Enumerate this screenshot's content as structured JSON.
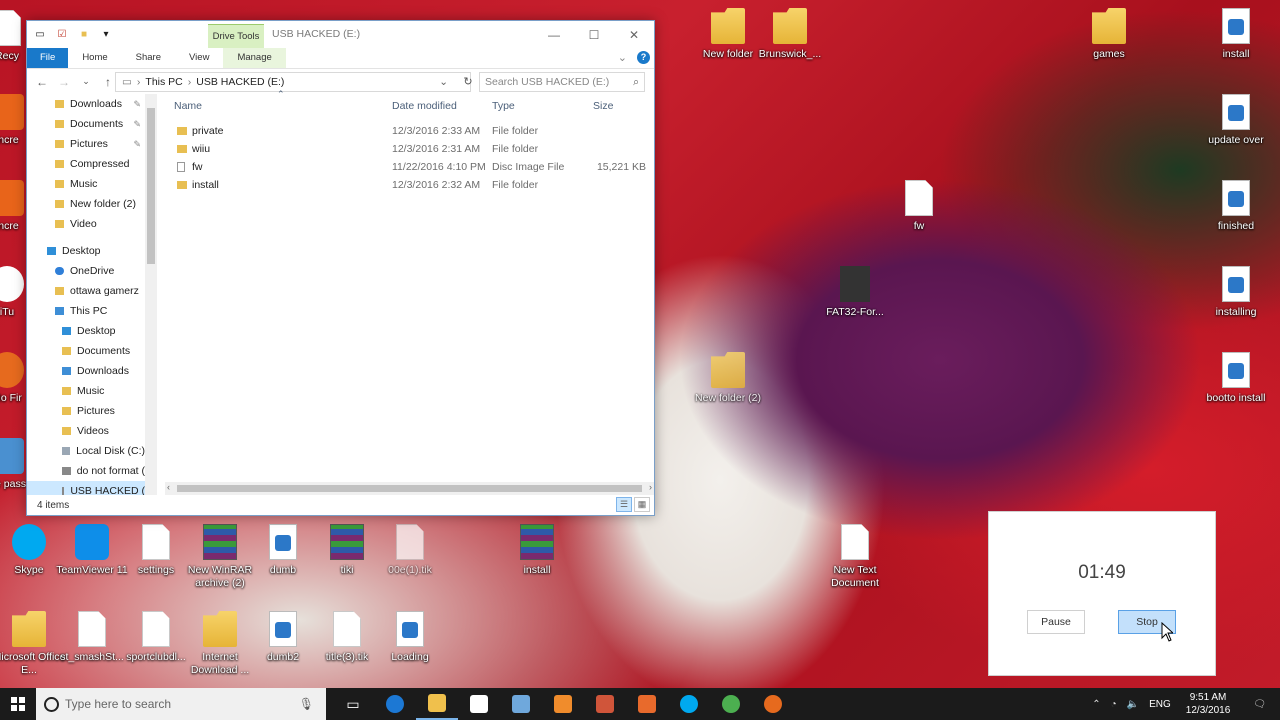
{
  "desktop": {
    "icons_top": [
      {
        "label": "New folder"
      },
      {
        "label": "Brunswick_..."
      },
      {
        "label": "games"
      },
      {
        "label": "install"
      },
      {
        "label": "update over"
      },
      {
        "label": "fw"
      },
      {
        "label": "finished"
      },
      {
        "label": "FAT32-For..."
      },
      {
        "label": "installing"
      },
      {
        "label": "New folder (2)"
      },
      {
        "label": "bootto install"
      }
    ],
    "icons_bottom_row1": [
      {
        "label": "Skype"
      },
      {
        "label": "TeamViewer 11"
      },
      {
        "label": "settings"
      },
      {
        "label": "New WinRAR archive (2)"
      },
      {
        "label": "dumb"
      },
      {
        "label": "tiki"
      },
      {
        "label": "00e(1).tik"
      },
      {
        "label": "install"
      },
      {
        "label": "New Text Document"
      }
    ],
    "icons_bottom_row2": [
      {
        "label": "Microsoft Office E..."
      },
      {
        "label": "st_smashSt..."
      },
      {
        "label": "sportclubdl..."
      },
      {
        "label": "Internet Download ..."
      },
      {
        "label": "dumb2"
      },
      {
        "label": "title(3).tik"
      },
      {
        "label": "Loading"
      }
    ],
    "left_partial_labels": [
      "Recy",
      "Incre",
      "Incre",
      "iTu",
      "Mo Fir",
      "Se pass"
    ]
  },
  "explorer": {
    "title": "USB HACKED (E:)",
    "drive_tools": "Drive Tools",
    "ribbon_tabs": [
      "File",
      "Home",
      "Share",
      "View",
      "Manage"
    ],
    "address": {
      "segments": [
        "This PC",
        "USB HACKED (E:)"
      ]
    },
    "search_placeholder": "Search USB HACKED (E:)",
    "nav_items": [
      {
        "label": "Downloads",
        "pinned": true
      },
      {
        "label": "Documents",
        "pinned": true
      },
      {
        "label": "Pictures",
        "pinned": true
      },
      {
        "label": "Compressed",
        "pinned": false
      },
      {
        "label": "Music",
        "pinned": false
      },
      {
        "label": "New folder (2)",
        "pinned": false
      },
      {
        "label": "Video",
        "pinned": false
      },
      {
        "label": "Desktop",
        "pinned": false
      },
      {
        "label": "OneDrive",
        "pinned": false
      },
      {
        "label": "ottawa gamerz",
        "pinned": false
      },
      {
        "label": "This PC",
        "pinned": false
      },
      {
        "label": "Desktop",
        "pinned": false
      },
      {
        "label": "Documents",
        "pinned": false
      },
      {
        "label": "Downloads",
        "pinned": false
      },
      {
        "label": "Music",
        "pinned": false
      },
      {
        "label": "Pictures",
        "pinned": false
      },
      {
        "label": "Videos",
        "pinned": false
      },
      {
        "label": "Local Disk (C:)",
        "pinned": false
      },
      {
        "label": "do not format (",
        "pinned": false
      },
      {
        "label": "USB HACKED (",
        "pinned": false
      }
    ],
    "columns": {
      "name": "Name",
      "date": "Date modified",
      "type": "Type",
      "size": "Size"
    },
    "files": [
      {
        "name": "private",
        "date": "12/3/2016 2:33 AM",
        "type": "File folder",
        "size": ""
      },
      {
        "name": "wiiu",
        "date": "12/3/2016 2:31 AM",
        "type": "File folder",
        "size": ""
      },
      {
        "name": "fw",
        "date": "11/22/2016 4:10 PM",
        "type": "Disc Image File",
        "size": "15,221 KB"
      },
      {
        "name": "install",
        "date": "12/3/2016 2:32 AM",
        "type": "File folder",
        "size": ""
      }
    ],
    "status": "4 items"
  },
  "timer": {
    "time": "01:49",
    "pause": "Pause",
    "stop": "Stop"
  },
  "taskbar": {
    "search_placeholder": "Type here to search",
    "lang": "ENG",
    "time": "9:51 AM",
    "date": "12/3/2016"
  }
}
